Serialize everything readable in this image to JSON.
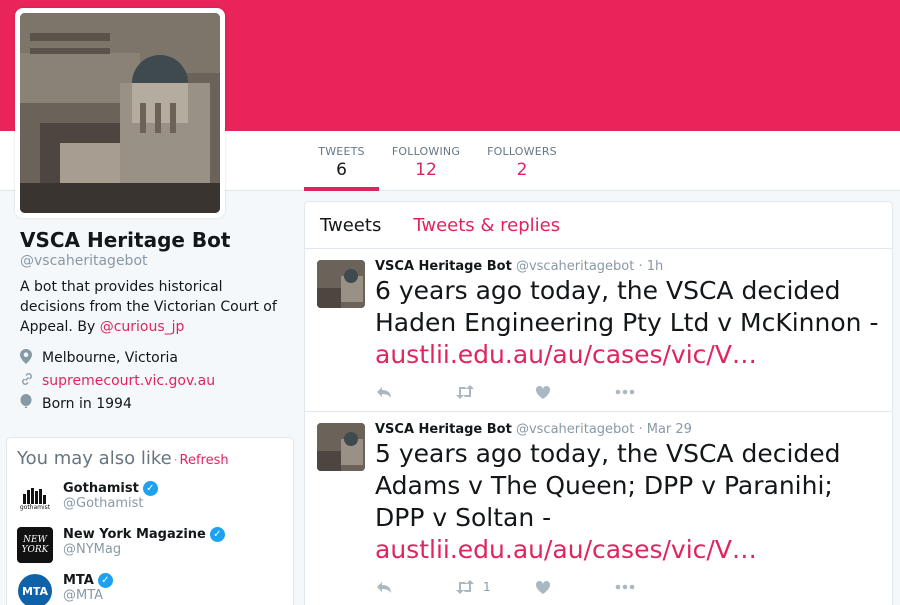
{
  "profile": {
    "name": "VSCA Heritage Bot",
    "handle": "@vscaheritagebot",
    "bio_text": "A bot that provides historical decisions from the Victorian Court of Appeal. By ",
    "bio_link": "@curious_jp",
    "location": "Melbourne, Victoria",
    "website": "supremecourt.vic.gov.au",
    "born": "Born in 1994"
  },
  "stats": [
    {
      "label": "TWEETS",
      "value": "6"
    },
    {
      "label": "FOLLOWING",
      "value": "12"
    },
    {
      "label": "FOLLOWERS",
      "value": "2"
    }
  ],
  "suggestions": {
    "title": "You may also like",
    "separator": "·",
    "refresh": "Refresh",
    "items": [
      {
        "name": "Gothamist",
        "handle": "@Gothamist",
        "avatar_text": "gothamist"
      },
      {
        "name": "New York Magazine",
        "handle": "@NYMag",
        "avatar_text": "NEW YORK"
      },
      {
        "name": "MTA",
        "handle": "@MTA",
        "avatar_text": "MTA"
      }
    ]
  },
  "timeline": {
    "tabs": [
      "Tweets",
      "Tweets & replies"
    ],
    "tweets": [
      {
        "name": "VSCA Heritage Bot",
        "handle": "@vscaheritagebot",
        "time": "· 1h",
        "text": "6 years ago today, the VSCA decided Haden Engineering Pty Ltd v McKinnon - ",
        "link": "austlii.edu.au/au/cases/vic/V…",
        "retweets": ""
      },
      {
        "name": "VSCA Heritage Bot",
        "handle": "@vscaheritagebot",
        "time": "· Mar 29",
        "text": "5 years ago today, the VSCA decided Adams v The Queen; DPP v Paranihi; DPP v Soltan - ",
        "link": "austlii.edu.au/au/cases/vic/V…",
        "retweets": "1"
      }
    ]
  },
  "icons": {
    "location": "map-pin-icon",
    "website": "link-icon",
    "born": "balloon-icon",
    "reply": "reply-icon",
    "retweet": "retweet-icon",
    "like": "heart-icon",
    "more": "more-icon",
    "verified": "verified-badge-icon"
  },
  "colors": {
    "banner": "#e8245a",
    "accent": "#e0245e",
    "verified": "#1da1f2"
  }
}
